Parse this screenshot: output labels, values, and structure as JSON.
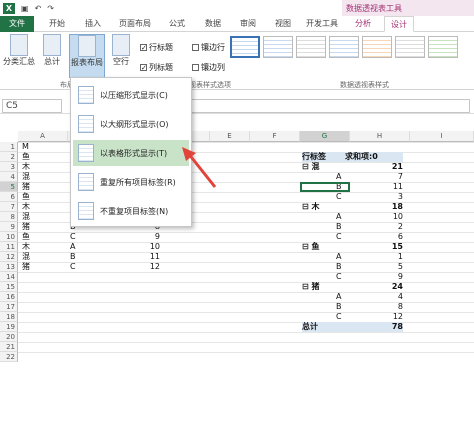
{
  "titlebar": {
    "context_group": "数据透视表工具"
  },
  "tabs": {
    "file": "文件",
    "home": "开始",
    "insert": "插入",
    "page_layout": "页面布局",
    "formulas": "公式",
    "data": "数据",
    "review": "审阅",
    "view": "视图",
    "developer": "开发工具",
    "analyze": "分析",
    "design": "设计"
  },
  "ribbon": {
    "subtotal": "分类汇总",
    "grand_total": "总计",
    "report_layout": "报表布局",
    "blank_rows": "空行",
    "row_headers": "行标题",
    "banded_rows": "镶边行",
    "col_headers": "列标题",
    "banded_cols": "镶边列",
    "group_layout": "布局",
    "group_style_options": "数据透视表样式选项",
    "group_styles": "数据透视表样式"
  },
  "formula": {
    "namebox": "C5"
  },
  "menu": {
    "items": [
      "以压缩形式显示(C)",
      "以大纲形式显示(O)",
      "以表格形式显示(T)",
      "重复所有项目标签(R)",
      "不重复项目标签(N)"
    ]
  },
  "columns": [
    "A",
    "",
    "",
    "",
    "E",
    "F",
    "G",
    "H",
    "I"
  ],
  "rows": [
    "1",
    "2",
    "3",
    "4",
    "5",
    "6",
    "7",
    "8",
    "9",
    "10",
    "11",
    "12",
    "13",
    "14",
    "15",
    "16",
    "17",
    "18",
    "19",
    "20",
    "21",
    "22"
  ],
  "source": {
    "rows": [
      [
        "M",
        "",
        ""
      ],
      [
        "鱼",
        "",
        ""
      ],
      [
        "木",
        "",
        ""
      ],
      [
        "混",
        "",
        ""
      ],
      [
        "猪",
        "",
        ""
      ],
      [
        "鱼",
        "",
        ""
      ],
      [
        "木",
        "",
        ""
      ],
      [
        "混",
        "A",
        "7"
      ],
      [
        "猪",
        "B",
        "8"
      ],
      [
        "鱼",
        "C",
        "9"
      ],
      [
        "木",
        "A",
        "10"
      ],
      [
        "混",
        "B",
        "11"
      ],
      [
        "猪",
        "C",
        "12"
      ]
    ]
  },
  "pivot": {
    "header_row": "行标签",
    "header_sum": "求和项:0",
    "groups": [
      {
        "name": "混",
        "total": "21",
        "items": [
          [
            "A",
            "7"
          ],
          [
            "B",
            "11"
          ],
          [
            "C",
            "3"
          ]
        ]
      },
      {
        "name": "木",
        "total": "18",
        "items": [
          [
            "A",
            "10"
          ],
          [
            "B",
            "2"
          ],
          [
            "C",
            "6"
          ]
        ]
      },
      {
        "name": "鱼",
        "total": "15",
        "items": [
          [
            "A",
            "1"
          ],
          [
            "B",
            "5"
          ],
          [
            "C",
            "9"
          ]
        ]
      },
      {
        "name": "猪",
        "total": "24",
        "items": [
          [
            "A",
            "4"
          ],
          [
            "B",
            "8"
          ],
          [
            "C",
            "12"
          ]
        ]
      }
    ],
    "grand_label": "总计",
    "grand_total": "78"
  },
  "colors": {
    "excel_green": "#217346",
    "context_pink": "#a33175",
    "highlight": "#c9e3c9",
    "arrow": "#e0443b"
  }
}
